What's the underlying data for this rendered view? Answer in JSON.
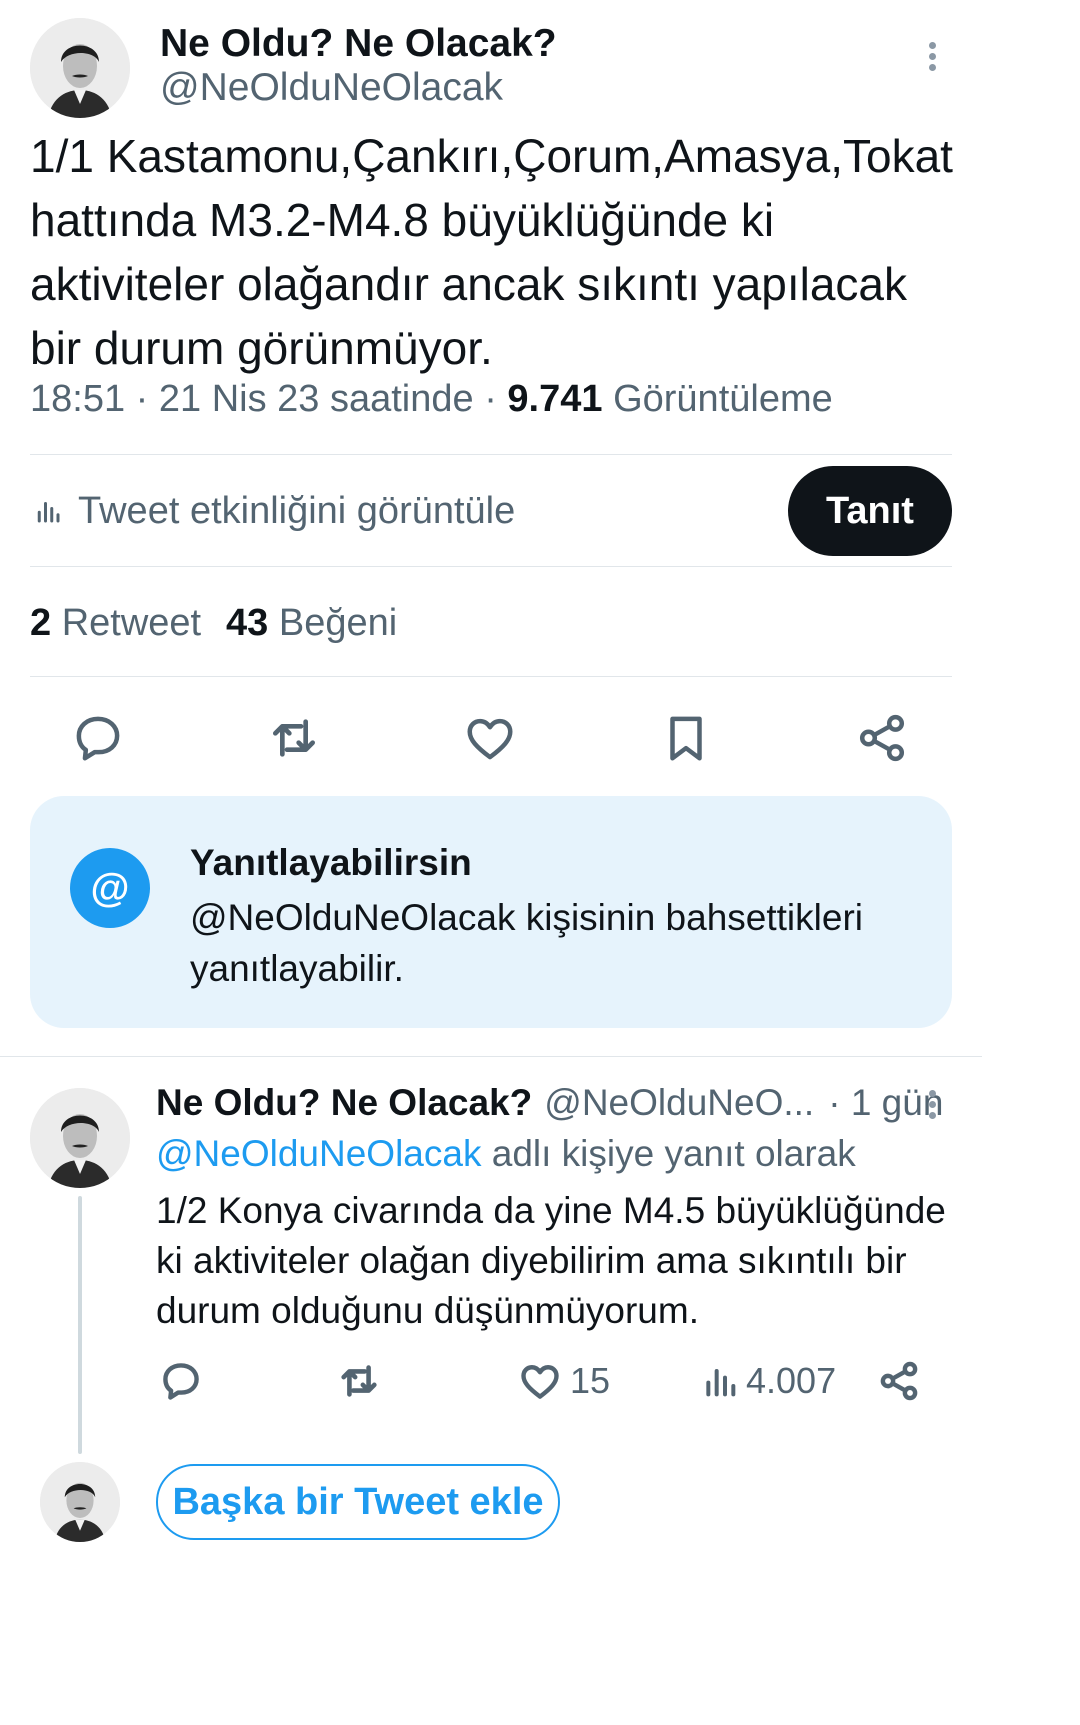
{
  "tweet": {
    "author_name": "Ne Oldu? Ne Olacak?",
    "author_handle": "@NeOlduNeOlacak",
    "text": "1/1 Kastamonu,Çankırı,Çorum,Amasya,Tokat hattında M3.2-M4.8 büyüklüğünde ki aktiviteler olağandır ancak sıkıntı yapılacak bir durum görünmüyor.",
    "time": "18:51",
    "date": "21 Nis 23 saatinde",
    "separator": "·",
    "views_count": "9.741",
    "views_label": "Görüntüleme",
    "analytics_label": "Tweet etkinliğini görüntüle",
    "promote_label": "Tanıt",
    "retweet_count": "2",
    "retweet_label": "Retweet",
    "like_count": "43",
    "like_label": "Beğeni",
    "actions": [
      "reply-icon",
      "retweet-icon",
      "heart-icon",
      "bookmark-icon",
      "share-icon"
    ]
  },
  "notice": {
    "icon_symbol": "@",
    "title": "Yanıtlayabilirsin",
    "body": "@NeOlduNeOlacak kişisinin bahsettikleri yanıtlayabilir."
  },
  "reply": {
    "author_name": "Ne Oldu? Ne Olacak?",
    "author_handle": "@NeOlduNeO...",
    "time_ago": "· 1 gün",
    "replying_to_handle": "@NeOlduNeOlacak",
    "replying_to_suffix": "adlı kişiye yanıt olarak",
    "text": "1/2 Konya civarında da yine M4.5 büyüklüğünde ki aktiviteler olağan diyebilirim ama sıkıntılı bir durum olduğunu düşünmüyorum.",
    "like_count": "15",
    "views_count": "4.007"
  },
  "composer": {
    "add_tweet_label": "Başka bir Tweet ekle"
  },
  "colors": {
    "accent": "#1d9bf0",
    "notice_bg": "#e6f3fc",
    "text": "#0f1419",
    "muted": "#536471"
  }
}
